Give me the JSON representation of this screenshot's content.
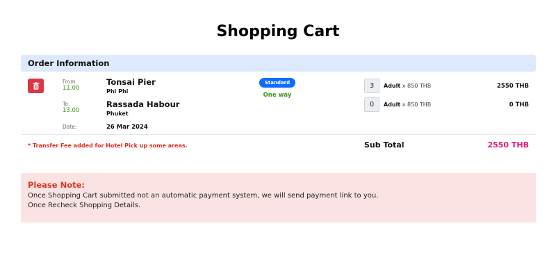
{
  "page": {
    "title": "Shopping Cart"
  },
  "order": {
    "header": "Order Information",
    "from_label": "From",
    "from_time": "11.00",
    "from_location": "Tonsai Pier",
    "from_sub": "Phi Phi",
    "to_label": "To",
    "to_time": "13.00",
    "to_location": "Rassada Habour",
    "to_sub": "Phuket",
    "date_label": "Date:",
    "date_value": "26 Mar 2024",
    "badge": "Standard",
    "trip_type": "One way",
    "items": [
      {
        "qty": "3",
        "label": "Adult",
        "price": "x 850 THB",
        "total": "2550 THB"
      },
      {
        "qty": "0",
        "label": "Adult",
        "price": "x 850 THB",
        "total": "0 THB"
      }
    ],
    "transfer_note": "* Transfer Fee added for Hotel Pick up some areas.",
    "subtotal_label": "Sub Total",
    "subtotal_value": "2550 THB"
  },
  "note": {
    "title": "Please Note:",
    "line1": "Once Shopping Cart submitted not an automatic payment system, we will send payment link to you.",
    "line2": "Once Recheck Shopping Details."
  },
  "colors": {
    "header_bg": "#dde9fc",
    "delete_red": "#dc3545",
    "badge_blue": "#0d6efd",
    "green": "#3a9a1a",
    "warning_red": "#e0271a",
    "subtotal_pink": "#e8197d",
    "note_bg": "#fbe3e3"
  },
  "icons": {
    "delete": "trash-icon"
  }
}
